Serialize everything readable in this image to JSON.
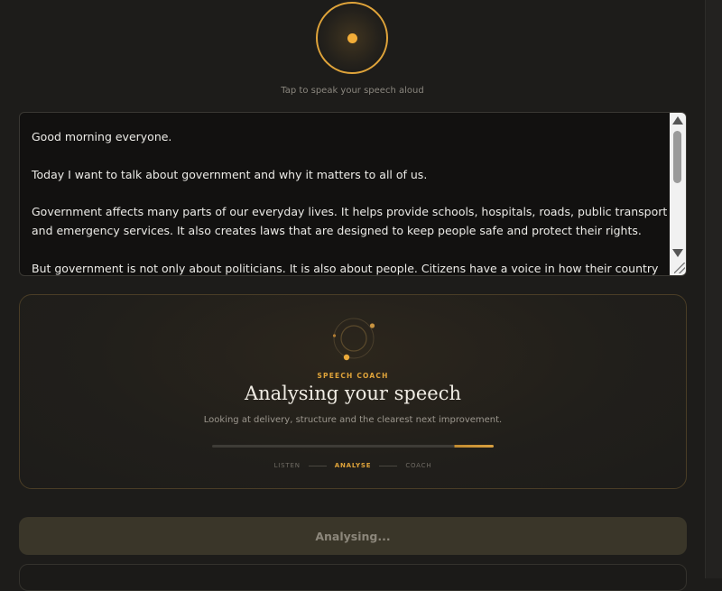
{
  "mic": {
    "hint": "Tap to speak your speech aloud",
    "icon": "microphone-record-icon"
  },
  "speech": {
    "text": "Good morning everyone.\n\nToday I want to talk about government and why it matters to all of us.\n\nGovernment affects many parts of our everyday lives. It helps provide schools, hospitals, roads, public transport and emergency services. It also creates laws that are designed to keep people safe and protect their rights.\n\nBut government is not only about politicians. It is also about people. Citizens have a voice in how their country is run through"
  },
  "coach": {
    "label": "SPEECH COACH",
    "title": "Analysing your speech",
    "subtitle": "Looking at delivery, structure and the clearest next improvement.",
    "progress": 0.14,
    "steps": [
      {
        "label": "LISTEN",
        "active": false
      },
      {
        "label": "ANALYSE",
        "active": true
      },
      {
        "label": "COACH",
        "active": false
      }
    ]
  },
  "action": {
    "button_label": "Analysing..."
  },
  "colors": {
    "accent": "#e0a43a",
    "background": "#1d1c1a",
    "editor_background": "#121110"
  }
}
